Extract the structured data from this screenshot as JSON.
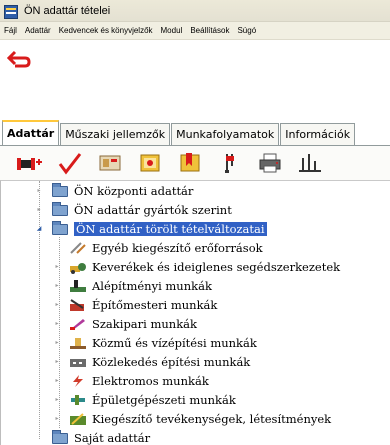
{
  "window": {
    "title": "ÖN adattár tételei"
  },
  "menu": [
    "Fájl",
    "Adattár",
    "Kedvencek és könyvjelzők",
    "Modul",
    "Beállítások",
    "Súgó"
  ],
  "tabs": [
    "Adattár",
    "Műszaki jellemzők",
    "Munkafolyamatok",
    "Információk"
  ],
  "active_tab": "Adattár",
  "toolbar_icons": [
    "add-pipe-icon",
    "checkmark-icon",
    "component-icon",
    "book-icon",
    "bookmark-book-icon",
    "tuning-fork-icon",
    "printer-icon",
    "chart-icon"
  ],
  "tree": [
    {
      "label": "ÖN központi adattár",
      "level": 1,
      "icon": "folder-icon",
      "color": "#7fa3cf"
    },
    {
      "label": "ÖN adattár gyártók szerint",
      "level": 1,
      "icon": "folder-icon",
      "color": "#7fa3cf"
    },
    {
      "label": "ÖN adattár törölt tételváltozatai",
      "level": 1,
      "icon": "folder-icon",
      "color": "#7fa3cf",
      "selected": true
    },
    {
      "label": "Egyéb kiegészítő erőforrások",
      "level": 2,
      "icon": "tools-icon",
      "color": "#c47a2c"
    },
    {
      "label": "Keverékek és ideiglenes segédszerkezetek",
      "level": 2,
      "icon": "mixer-icon",
      "color": "#d9a62c"
    },
    {
      "label": "Alépítményi munkák",
      "level": 2,
      "icon": "foundation-icon",
      "color": "#3f7d3f"
    },
    {
      "label": "Építőmesteri munkák",
      "level": 2,
      "icon": "bricks-icon",
      "color": "#c0392b"
    },
    {
      "label": "Szakipari munkák",
      "level": 2,
      "icon": "saw-icon",
      "color": "#b03a9b"
    },
    {
      "label": "Közmű és vízépítési munkák",
      "level": 2,
      "icon": "water-icon",
      "color": "#8a5a2c"
    },
    {
      "label": "Közlekedés építési munkák",
      "level": 2,
      "icon": "road-icon",
      "color": "#6b6b6b"
    },
    {
      "label": "Elektromos munkák",
      "level": 2,
      "icon": "lightning-icon",
      "color": "#d13b2a"
    },
    {
      "label": "Épületgépészeti munkák",
      "level": 2,
      "icon": "pipe-icon",
      "color": "#2c8a8a"
    },
    {
      "label": "Kiegészítő tevékenységek, létesítmények",
      "level": 2,
      "icon": "shovel-icon",
      "color": "#5a8a2c"
    },
    {
      "label": "Saját adattár",
      "level": 1,
      "icon": "folder-icon",
      "color": "#7fa3cf"
    }
  ]
}
